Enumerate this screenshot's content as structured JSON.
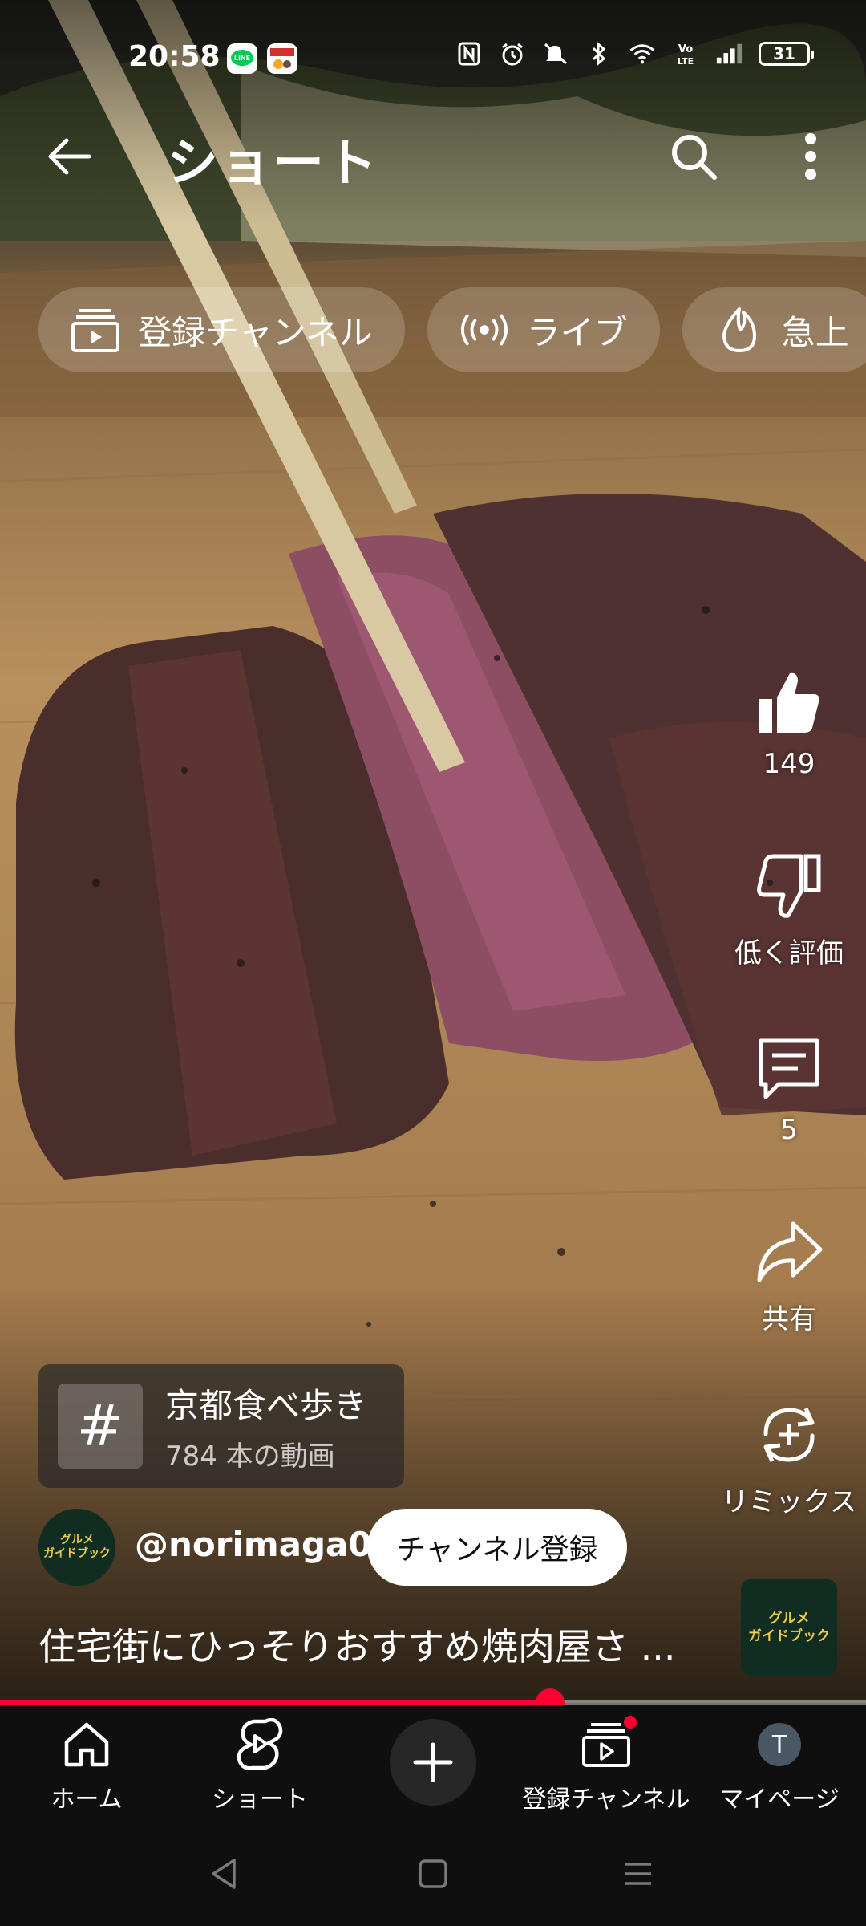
{
  "status_bar": {
    "time": "20:58",
    "app_icons": [
      "line-app-icon",
      "game-app-icon"
    ],
    "icons": [
      "nfc-icon",
      "alarm-icon",
      "mute-icon",
      "bluetooth-icon",
      "wifi-icon",
      "volte-icon",
      "signal-icon"
    ],
    "battery": "31"
  },
  "header": {
    "title": "ショート"
  },
  "chips": [
    {
      "label": "登録チャンネル",
      "icon": "subscriptions-icon"
    },
    {
      "label": "ライブ",
      "icon": "live-icon"
    },
    {
      "label": "急上",
      "icon": "trending-icon"
    }
  ],
  "actions": {
    "like_count": "149",
    "dislike_label": "低く評価",
    "comment_count": "5",
    "share_label": "共有",
    "remix_label": "リミックス"
  },
  "hashtag": {
    "title": "京都食べ歩き",
    "subtitle": "784 本の動画"
  },
  "channel": {
    "avatar_text": "グルメ\nガイドブック",
    "name": "@norimaga01",
    "subscribe_label": "チャンネル登録"
  },
  "video": {
    "title": "住宅街にひっそりおすすめ焼肉屋さ ...",
    "sound_thumb_text": "グルメ\nガイドブック",
    "progress": 0.635
  },
  "bottom_nav": {
    "home": "ホーム",
    "shorts": "ショート",
    "subscriptions": "登録チャンネル",
    "mypage": "マイページ",
    "avatar_letter": "T"
  },
  "colors": {
    "accent": "#ff0033",
    "nav_bg": "#0f0f0f"
  }
}
